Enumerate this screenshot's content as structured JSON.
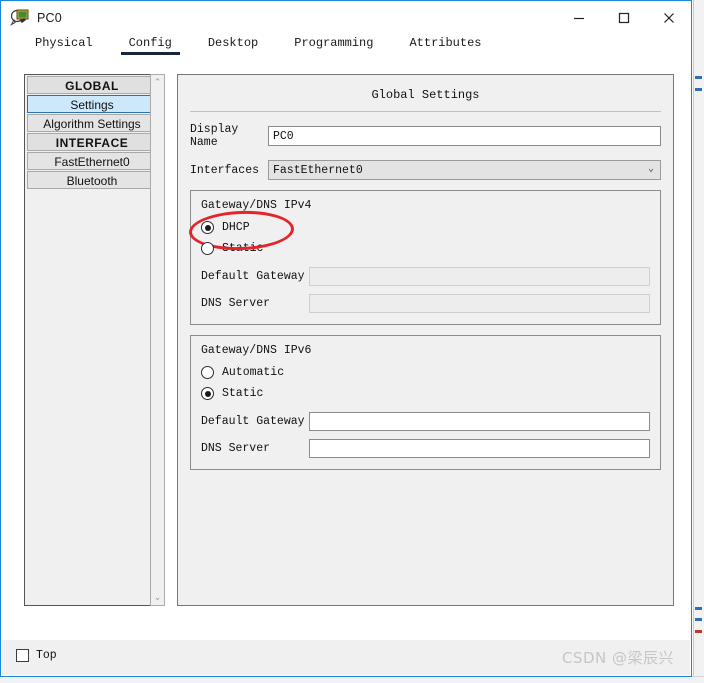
{
  "window": {
    "title": "PC0",
    "icon": "packet-tracer-device-icon",
    "accent_color": "#1a86d8",
    "controls": {
      "minimize": "—",
      "maximize": "□",
      "close": "✕"
    }
  },
  "tabs": [
    {
      "label": "Physical",
      "active": false
    },
    {
      "label": "Config",
      "active": true
    },
    {
      "label": "Desktop",
      "active": false
    },
    {
      "label": "Programming",
      "active": false
    },
    {
      "label": "Attributes",
      "active": false
    }
  ],
  "sidebar": {
    "items": [
      {
        "label": "GLOBAL",
        "type": "header",
        "selected": false
      },
      {
        "label": "Settings",
        "type": "item",
        "selected": true
      },
      {
        "label": "Algorithm Settings",
        "type": "item",
        "selected": false
      },
      {
        "label": "INTERFACE",
        "type": "header",
        "selected": false
      },
      {
        "label": "FastEthernet0",
        "type": "item",
        "selected": false
      },
      {
        "label": "Bluetooth",
        "type": "item",
        "selected": false
      }
    ],
    "scrollbar": {
      "up_arrow": "⌃",
      "down_arrow": "⌄"
    }
  },
  "panel": {
    "title": "Global Settings",
    "display_name": {
      "label": "Display Name",
      "value": "PC0",
      "placeholder": ""
    },
    "interfaces": {
      "label": "Interfaces",
      "value": "FastEthernet0",
      "chevron": "⌄"
    },
    "ipv4": {
      "caption": "Gateway/DNS IPv4",
      "options": [
        {
          "label": "DHCP",
          "selected": true
        },
        {
          "label": "Static",
          "selected": false
        }
      ],
      "default_gateway": {
        "label": "Default Gateway",
        "value": "",
        "disabled": true
      },
      "dns_server": {
        "label": "DNS Server",
        "value": "",
        "disabled": true
      },
      "annotation_color": "#e4242a"
    },
    "ipv6": {
      "caption": "Gateway/DNS IPv6",
      "options": [
        {
          "label": "Automatic",
          "selected": false
        },
        {
          "label": "Static",
          "selected": true
        }
      ],
      "default_gateway": {
        "label": "Default Gateway",
        "value": "",
        "disabled": false
      },
      "dns_server": {
        "label": "DNS Server",
        "value": "",
        "disabled": false
      }
    }
  },
  "footer": {
    "top_checkbox": {
      "label": "Top",
      "checked": false
    },
    "watermark": "CSDN @梁辰兴"
  }
}
